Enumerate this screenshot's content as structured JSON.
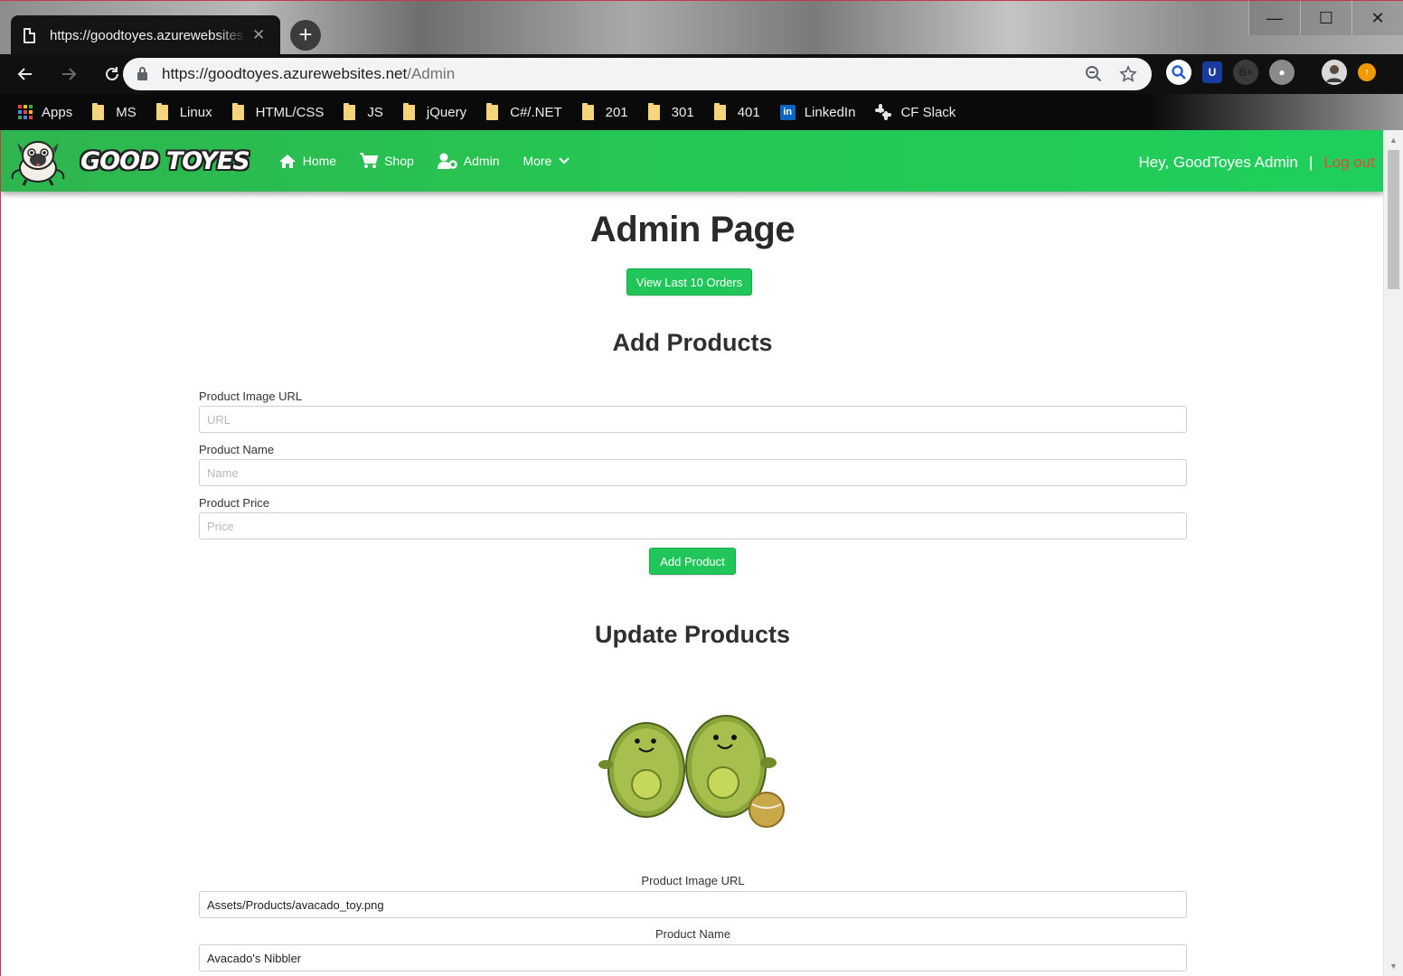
{
  "browser": {
    "tab_title": "https://goodtoyes.azurewebsites.net/Admin",
    "tab_close": "✕",
    "new_tab": "+",
    "url_host": "https://goodtoyes.azurewebsites.net",
    "url_path": "/Admin",
    "window_controls": {
      "minimize": "—",
      "maximize": "☐",
      "close": "✕"
    },
    "bookmarks": [
      {
        "label": "Apps",
        "icon": "apps-grid-icon"
      },
      {
        "label": "MS",
        "icon": "folder-icon"
      },
      {
        "label": "Linux",
        "icon": "folder-icon"
      },
      {
        "label": "HTML/CSS",
        "icon": "folder-icon"
      },
      {
        "label": "JS",
        "icon": "folder-icon"
      },
      {
        "label": "jQuery",
        "icon": "folder-icon"
      },
      {
        "label": "C#/.NET",
        "icon": "folder-icon"
      },
      {
        "label": "201",
        "icon": "folder-icon"
      },
      {
        "label": "301",
        "icon": "folder-icon"
      },
      {
        "label": "401",
        "icon": "folder-icon"
      },
      {
        "label": "LinkedIn",
        "icon": "linkedin-icon"
      },
      {
        "label": "CF Slack",
        "icon": "slack-icon"
      }
    ]
  },
  "site": {
    "brand": "GOOD TOYES",
    "nav": {
      "home": "Home",
      "shop": "Shop",
      "admin": "Admin",
      "more": "More"
    },
    "greeting": "Hey, GoodToyes Admin",
    "separator": "|",
    "logout": "Log out"
  },
  "page": {
    "title": "Admin Page",
    "view_orders_button": "View Last 10 Orders",
    "add_section": {
      "title": "Add Products",
      "image_url_label": "Product Image URL",
      "image_url_placeholder": "URL",
      "name_label": "Product Name",
      "name_placeholder": "Name",
      "price_label": "Product Price",
      "price_placeholder": "Price",
      "submit": "Add Product"
    },
    "update_section": {
      "title": "Update Products",
      "image_url_label": "Product Image URL",
      "image_url_value": "Assets/Products/avacado_toy.png",
      "name_label": "Product Name",
      "name_value": "Avacado's Nibbler"
    }
  },
  "colors": {
    "nav_green": "#25c653",
    "button_green": "#21c65a",
    "logout_red": "#e8463a"
  }
}
